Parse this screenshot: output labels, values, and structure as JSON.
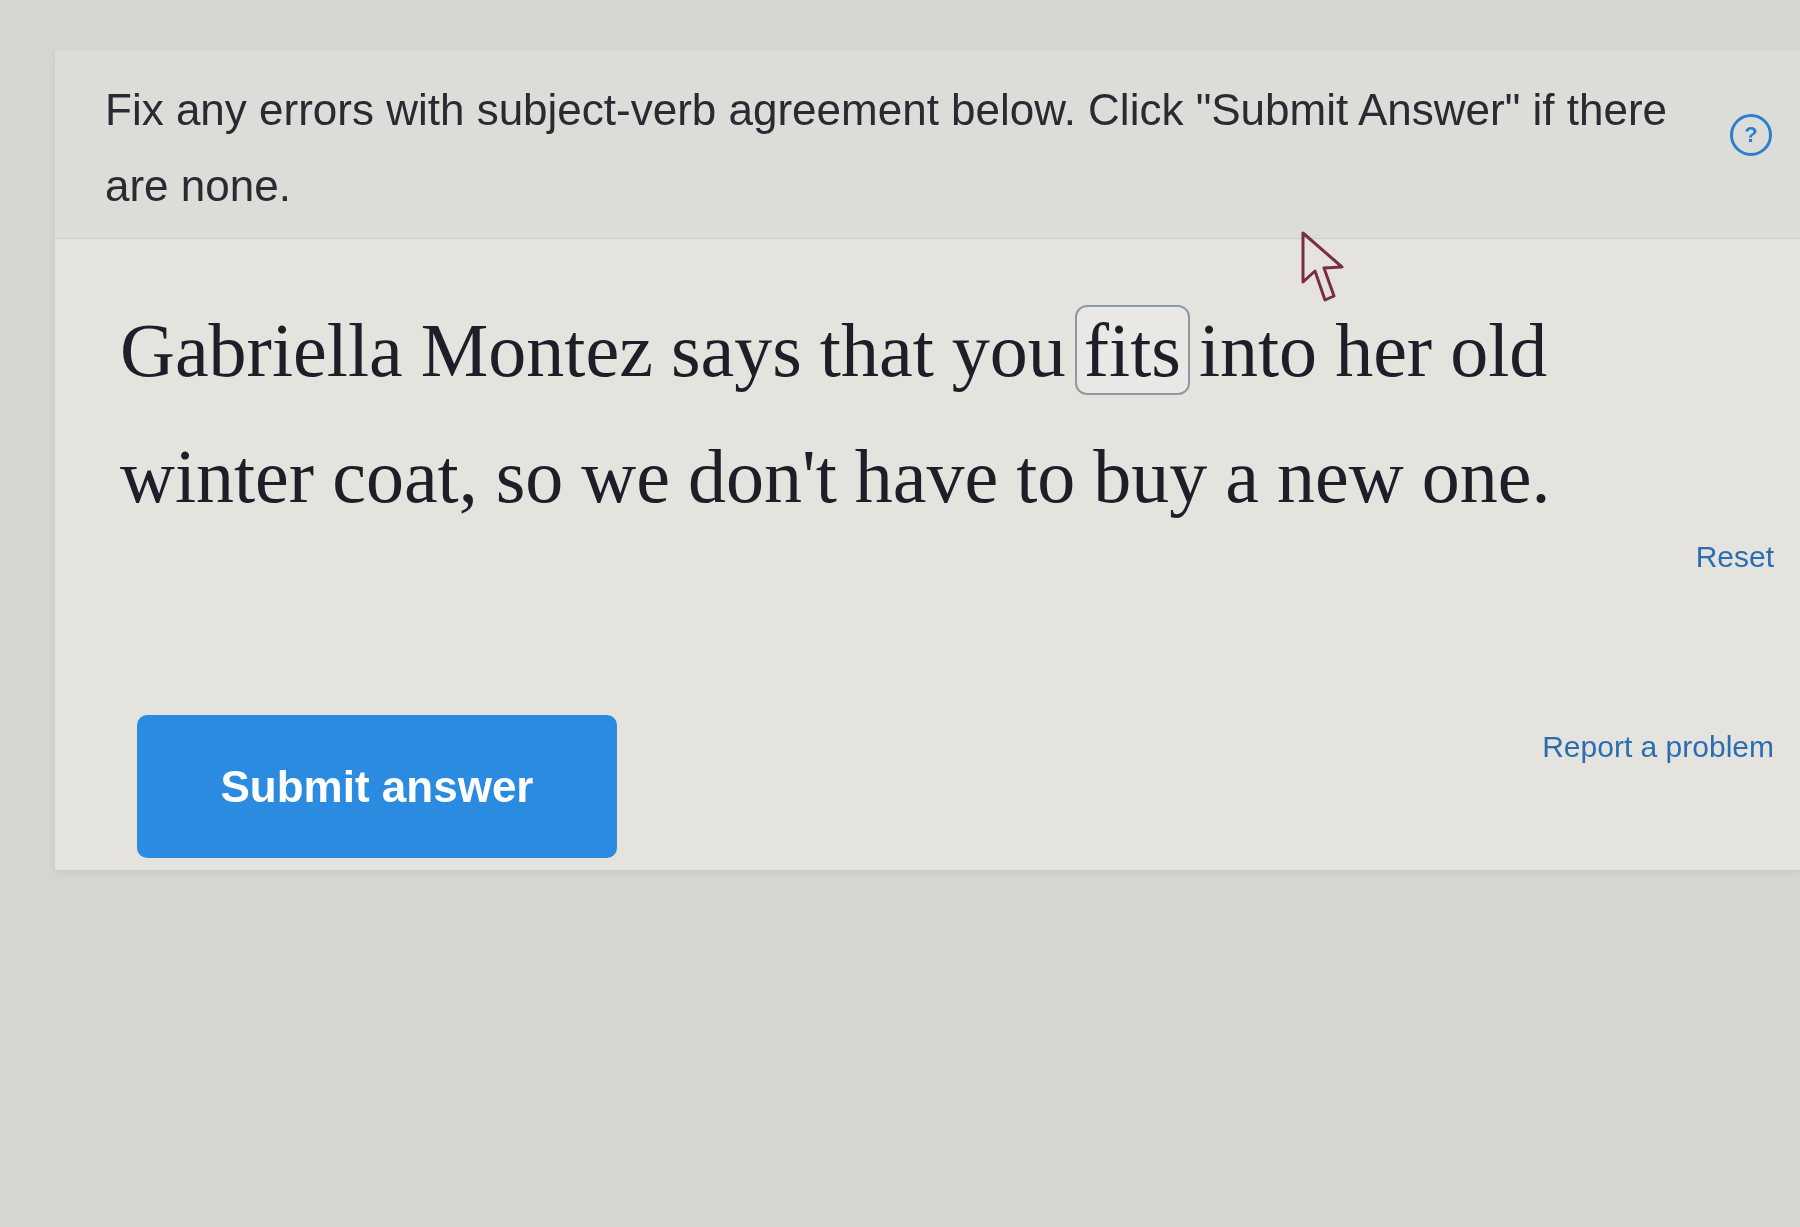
{
  "instructions": {
    "text": "Fix any errors with subject-verb agreement below. Click \"Submit Answer\" if there are none.",
    "help_label": "?"
  },
  "sentence": {
    "words": [
      {
        "text": "Gabriella",
        "selected": false
      },
      {
        "text": "Montez",
        "selected": false
      },
      {
        "text": "says",
        "selected": false
      },
      {
        "text": "that",
        "selected": false
      },
      {
        "text": "you",
        "selected": false
      },
      {
        "text": "fits",
        "selected": true
      },
      {
        "text": "into",
        "selected": false
      },
      {
        "text": "her",
        "selected": false
      },
      {
        "text": "old",
        "selected": false
      },
      {
        "text": "winter",
        "selected": false
      },
      {
        "text": "coat,",
        "selected": false
      },
      {
        "text": "so",
        "selected": false
      },
      {
        "text": "we",
        "selected": false
      },
      {
        "text": "don't",
        "selected": false
      },
      {
        "text": "have",
        "selected": false
      },
      {
        "text": "to",
        "selected": false
      },
      {
        "text": "buy",
        "selected": false
      },
      {
        "text": "a",
        "selected": false
      },
      {
        "text": "new",
        "selected": false
      },
      {
        "text": "one.",
        "selected": false
      }
    ]
  },
  "reset_link": "Reset",
  "submit_button": "Submit answer",
  "report_link": "Report a problem"
}
